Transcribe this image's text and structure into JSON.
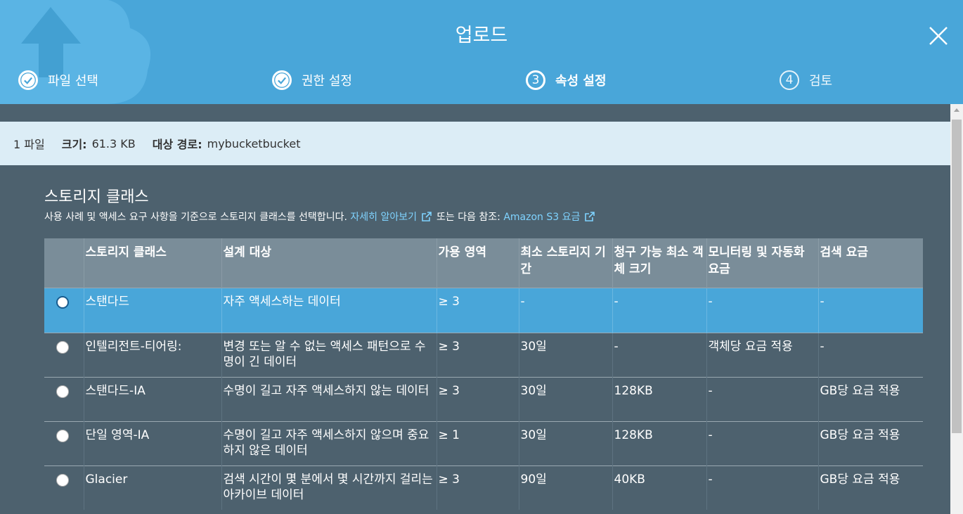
{
  "header": {
    "title": "업로드"
  },
  "steps": [
    {
      "label": "파일 선택",
      "state": "done"
    },
    {
      "label": "권한 설정",
      "state": "done"
    },
    {
      "label": "속성 설정",
      "state": "current",
      "num": "3"
    },
    {
      "label": "검토",
      "state": "future",
      "num": "4"
    }
  ],
  "info": {
    "files": "1 파일",
    "size_label": "크기:",
    "size_value": "61.3 KB",
    "dest_label": "대상 경로:",
    "dest_value": "mybucketbucket"
  },
  "storage": {
    "title": "스토리지 클래스",
    "desc": "사용 사례 및 액세스 요구 사항을 기준으로 스토리지 클래스를 선택합니다.",
    "learn_more": "자세히 알아보기",
    "or_see": "또는 다음 참조:",
    "pricing_link": "Amazon S3 요금"
  },
  "table": {
    "headers": [
      "스토리지 클래스",
      "설계 대상",
      "가용 영역",
      "최소 스토리지 기간",
      "청구 가능 최소 객체 크기",
      "모니터링 및 자동화 요금",
      "검색 요금"
    ],
    "rows": [
      {
        "selected": true,
        "cells": [
          "스탠다드",
          "자주 액세스하는 데이터",
          "≥ 3",
          "-",
          "-",
          "-",
          "-"
        ]
      },
      {
        "selected": false,
        "cells": [
          "인텔리전트-티어링:",
          "변경 또는 알 수 없는 액세스 패턴으로 수명이 긴 데이터",
          "≥ 3",
          "30일",
          "-",
          "객체당 요금 적용",
          "-"
        ]
      },
      {
        "selected": false,
        "cells": [
          "스탠다드-IA",
          "수명이 길고 자주 액세스하지 않는 데이터",
          "≥ 3",
          "30일",
          "128KB",
          "-",
          "GB당 요금 적용"
        ]
      },
      {
        "selected": false,
        "cells": [
          "단일 영역-IA",
          "수명이 길고 자주 액세스하지 않으며 중요하지 않은 데이터",
          "≥ 1",
          "30일",
          "128KB",
          "-",
          "GB당 요금 적용"
        ]
      },
      {
        "selected": false,
        "cells": [
          "Glacier",
          "검색 시간이 몇 분에서 몇 시간까지 걸리는 아카이브 데이터",
          "≥ 3",
          "90일",
          "40KB",
          "-",
          "GB당 요금 적용"
        ]
      }
    ]
  },
  "colors": {
    "header": "#49a6d9",
    "body": "#4d616e",
    "infobar": "#dcedf6",
    "link": "#7fd3ff"
  },
  "icons": [
    "upload-cloud-icon",
    "close-icon",
    "check-icon",
    "external-link-icon"
  ]
}
